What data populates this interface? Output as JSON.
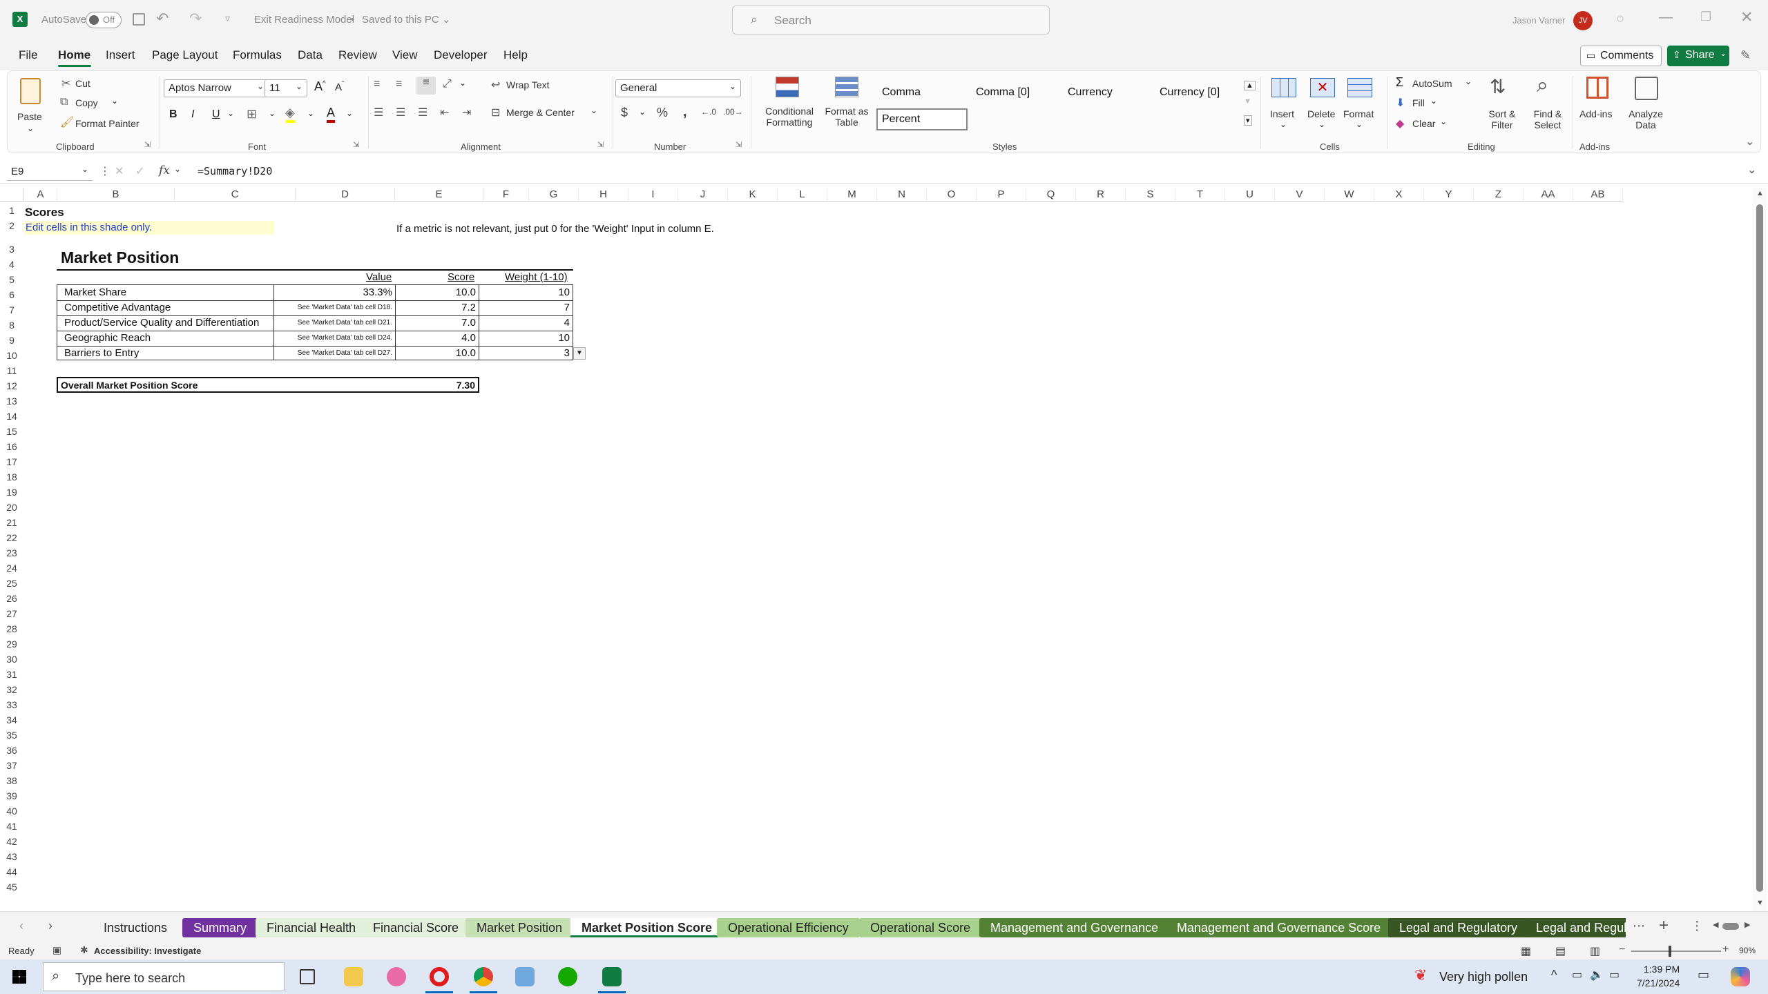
{
  "titlebar": {
    "autosave_label": "AutoSave",
    "autosave_state": "Off",
    "doc_title": "Exit Readiness Model",
    "doc_status": "Saved to this PC",
    "search_placeholder": "Search",
    "user_name": "Jason Varner",
    "user_initials": "JV"
  },
  "menu": {
    "items": [
      "File",
      "Home",
      "Insert",
      "Page Layout",
      "Formulas",
      "Data",
      "Review",
      "View",
      "Developer",
      "Help"
    ],
    "active": "Home",
    "comments_label": "Comments",
    "share_label": "Share"
  },
  "ribbon": {
    "clipboard": {
      "paste": "Paste",
      "cut": "Cut",
      "copy": "Copy",
      "format_painter": "Format Painter",
      "group": "Clipboard"
    },
    "font": {
      "name": "Aptos Narrow",
      "size": "11",
      "group": "Font"
    },
    "alignment": {
      "wrap_text": "Wrap Text",
      "merge_center": "Merge & Center",
      "group": "Alignment"
    },
    "number": {
      "format": "General",
      "group": "Number"
    },
    "styles": {
      "conditional_formatting": "Conditional Formatting",
      "format_as_table": "Format as Table",
      "cells": [
        "Comma",
        "Comma [0]",
        "Currency",
        "Currency [0]",
        "Percent"
      ],
      "group": "Styles"
    },
    "cells": {
      "insert": "Insert",
      "delete": "Delete",
      "format": "Format",
      "group": "Cells"
    },
    "editing": {
      "autosum": "AutoSum",
      "fill": "Fill",
      "clear": "Clear",
      "sort_filter": "Sort & Filter",
      "find_select": "Find & Select",
      "group": "Editing"
    },
    "addins": {
      "addins": "Add-ins",
      "analyze_data": "Analyze Data",
      "group": "Add-ins"
    }
  },
  "formula_bar": {
    "name_box": "E9",
    "fx": "fx",
    "formula": "=Summary!D20"
  },
  "columns": [
    "A",
    "B",
    "C",
    "D",
    "E",
    "F",
    "G",
    "H",
    "I",
    "J",
    "K",
    "L",
    "M",
    "N",
    "O",
    "P",
    "Q",
    "R",
    "S",
    "T",
    "U",
    "V",
    "W",
    "X",
    "Y",
    "Z",
    "AA",
    "AB"
  ],
  "sheet": {
    "title": "Scores",
    "edit_note": "Edit cells in this shade only.",
    "weight_note": "If a metric is not relevant, just put 0 for the 'Weight' Input in column E.",
    "section_title": "Market Position",
    "headers": {
      "value": "Value",
      "score": "Score",
      "weight": "Weight (1-10)"
    },
    "rows": [
      {
        "metric": "Market Share",
        "value": "33.3%",
        "score": "10.0",
        "weight": "10"
      },
      {
        "metric": "Competitive Advantage",
        "value": "See 'Market Data' tab cell D18.",
        "score": "7.2",
        "weight": "7"
      },
      {
        "metric": "Product/Service Quality and Differentiation",
        "value": "See 'Market Data' tab cell D21.",
        "score": "7.0",
        "weight": "4"
      },
      {
        "metric": "Geographic Reach",
        "value": "See 'Market Data' tab cell D24.",
        "score": "4.0",
        "weight": "10"
      },
      {
        "metric": "Barriers to Entry",
        "value": "See 'Market Data' tab cell D27.",
        "score": "10.0",
        "weight": "3"
      }
    ],
    "overall_label": "Overall Market Position Score",
    "overall_value": "7.30"
  },
  "sheet_tabs": [
    {
      "label": "Instructions",
      "bg": "#f3f3f3",
      "fg": "#222222"
    },
    {
      "label": "Summary",
      "bg": "#7030a0",
      "fg": "#ffffff"
    },
    {
      "label": "Financial Health",
      "bg": "#e2efda",
      "fg": "#222222"
    },
    {
      "label": "Financial Score",
      "bg": "#e2efda",
      "fg": "#222222"
    },
    {
      "label": "Market Position",
      "bg": "#c6e0b4",
      "fg": "#222222"
    },
    {
      "label": "Market Position Score",
      "bg": "#ffffff",
      "fg": "#222222"
    },
    {
      "label": "Operational Efficiency",
      "bg": "#a9d18e",
      "fg": "#222222"
    },
    {
      "label": "Operational Score",
      "bg": "#a9d18e",
      "fg": "#222222"
    },
    {
      "label": "Management and Governance",
      "bg": "#548235",
      "fg": "#ffffff"
    },
    {
      "label": "Management and Governance Score",
      "bg": "#548235",
      "fg": "#ffffff"
    },
    {
      "label": "Legal and Regulatory",
      "bg": "#375623",
      "fg": "#ffffff"
    },
    {
      "label": "Legal and Regula",
      "bg": "#375623",
      "fg": "#ffffff"
    }
  ],
  "status": {
    "ready": "Ready",
    "accessibility": "Accessibility: Investigate",
    "zoom": "90%"
  },
  "taskbar": {
    "search_placeholder": "Type here to search",
    "weather": "Very high pollen",
    "time": "1:39 PM",
    "date": "7/21/2024"
  }
}
